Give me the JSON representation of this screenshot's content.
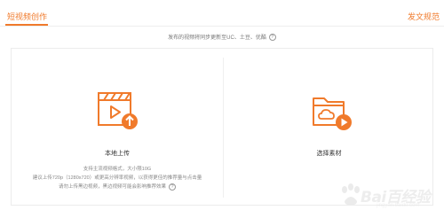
{
  "header": {
    "tab_label": "短视频创作",
    "spec_link": "发文规范"
  },
  "notice": {
    "text": "发布的视频将同步更新至UC、土豆、优酷",
    "help_icon": "?"
  },
  "upload_card": {
    "title": "本地上传",
    "hint_line1": "支持主流视频格式，大小限10G",
    "hint_line2": "建议上传720p（1280x720）或更高分辨率视频，以获得更佳的推荐量与点击量",
    "hint_line3": "请勿上传黑边视频，黑边视频可能会影响推荐效果",
    "help_icon": "?",
    "icon": "video-upload-icon"
  },
  "material_card": {
    "title": "选择素材",
    "icon": "cloud-folder-play-icon"
  },
  "watermark": {
    "brand": "Bai百经验",
    "sub": "jingyan.baidu.com"
  },
  "colors": {
    "accent": "#f07a2b",
    "border": "#ececec",
    "text": "#333333",
    "muted": "#888888"
  }
}
